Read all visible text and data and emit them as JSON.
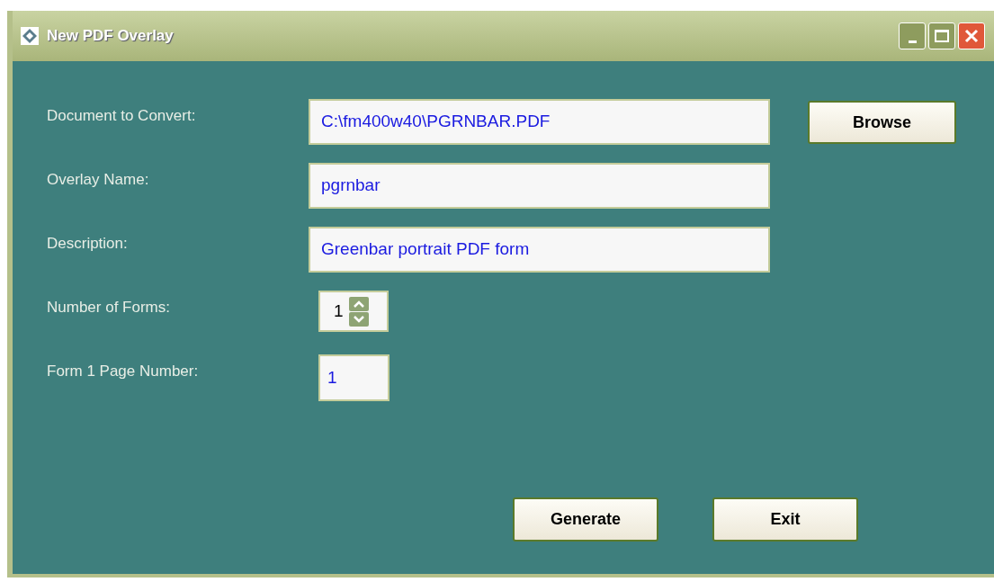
{
  "window": {
    "title": "New PDF Overlay"
  },
  "fields": [
    {
      "kind": "text",
      "label": "Document to Convert:",
      "value": "C:\\fm400w40\\PGRNBAR.PDF",
      "button": "Browse"
    },
    {
      "kind": "text",
      "label": "Overlay Name:",
      "value": "pgrnbar"
    },
    {
      "kind": "text",
      "label": "Description:",
      "value": "Greenbar portrait PDF form"
    },
    {
      "kind": "spinner",
      "label": "Number of Forms:",
      "value": "1"
    },
    {
      "kind": "short",
      "label": "Form 1 Page Number:",
      "value": "1"
    }
  ],
  "buttons": [
    "Generate",
    "Exit"
  ]
}
